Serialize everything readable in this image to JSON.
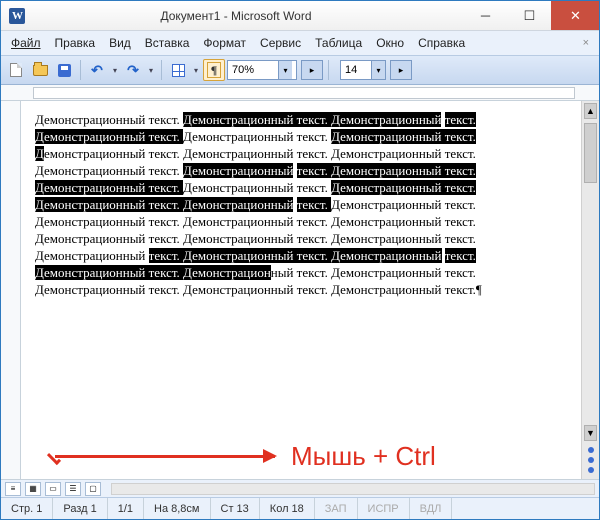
{
  "titlebar": {
    "title": "Документ1 - Microsoft Word"
  },
  "menubar": {
    "items": [
      "Файл",
      "Правка",
      "Вид",
      "Вставка",
      "Формат",
      "Сервис",
      "Таблица",
      "Окно",
      "Справка"
    ]
  },
  "toolbar": {
    "zoom": "70%",
    "fontsize": "14"
  },
  "document": {
    "segments": [
      {
        "t": "Демонстрационный текст. ",
        "h": false
      },
      {
        "t": "Демонстрационный текст. ",
        "h": true
      },
      {
        "t": "Демонстрационный",
        "h": true
      },
      {
        "t": " ",
        "h": false
      },
      {
        "t": "текст. ",
        "h": true
      },
      {
        "t": "Демонстрационный текст. ",
        "h": true
      },
      {
        "t": "Демонстрационный текст. ",
        "h": false
      },
      {
        "t": "Демонстрационный текст. ",
        "h": true
      },
      {
        "t": "Д",
        "h": true
      },
      {
        "t": "емонстрационный текст. ",
        "h": false
      },
      {
        "t": "Демонстрационный",
        "h": false
      },
      {
        "t": " ",
        "h": false
      },
      {
        "t": "текст. ",
        "h": false
      },
      {
        "t": "Демонстрационный текст. ",
        "h": false
      },
      {
        "t": "Демонстрационный текст. ",
        "h": false
      },
      {
        "t": "Демонстрационный",
        "h": true
      },
      {
        "t": " ",
        "h": false
      },
      {
        "t": "текст. ",
        "h": true
      },
      {
        "t": "Демонстрационный текст. ",
        "h": true
      },
      {
        "t": "Демонстрационный текст. ",
        "h": true
      },
      {
        "t": "Демонстрационный",
        "h": false
      },
      {
        "t": " ",
        "h": false
      },
      {
        "t": "текст. ",
        "h": false
      },
      {
        "t": "Демонстрационный текст. ",
        "h": true
      },
      {
        "t": "Демонстрационный текст. ",
        "h": true
      },
      {
        "t": "Демонстрационный",
        "h": true
      },
      {
        "t": " ",
        "h": false
      },
      {
        "t": "текст. ",
        "h": true
      },
      {
        "t": "Демонстрационный текст. ",
        "h": false
      },
      {
        "t": "Демонстрационный текст. ",
        "h": false
      },
      {
        "t": "Демонстрационный текст. ",
        "h": false
      },
      {
        "t": "Демонстрационный текст. ",
        "h": false
      },
      {
        "t": "Демонстрационный",
        "h": false
      },
      {
        "t": " ",
        "h": false
      },
      {
        "t": "текст. ",
        "h": false
      },
      {
        "t": "Демонстрационный текст. ",
        "h": false
      },
      {
        "t": "Демонстрационный текст. ",
        "h": false
      },
      {
        "t": "Демонстрационный ",
        "h": false
      },
      {
        "t": "текст. ",
        "h": true
      },
      {
        "t": "Демонстрационный текст. ",
        "h": true
      },
      {
        "t": "Демонстрационный",
        "h": true
      },
      {
        "t": " ",
        "h": false
      },
      {
        "t": "текст. ",
        "h": true
      },
      {
        "t": "Демонстрационный текст. ",
        "h": true
      },
      {
        "t": "Демонстрацион",
        "h": true
      },
      {
        "t": "ный текст. ",
        "h": false
      },
      {
        "t": "Демонстрационный текст. ",
        "h": false
      },
      {
        "t": "Демонстрационный текст. ",
        "h": false
      },
      {
        "t": "Демонстрационный",
        "h": false
      },
      {
        "t": " ",
        "h": false
      },
      {
        "t": "текст. ",
        "h": false
      },
      {
        "t": "Демонстрационный текст.¶",
        "h": false
      }
    ]
  },
  "annotation": {
    "label": "Мышь + Ctrl"
  },
  "statusbar": {
    "page": "Стр. 1",
    "section": "Разд 1",
    "pages": "1/1",
    "position": "На 8,8см",
    "line": "Ст 13",
    "col": "Кол 18",
    "modes": [
      "ЗАП",
      "ИСПР",
      "ВДЛ"
    ]
  }
}
